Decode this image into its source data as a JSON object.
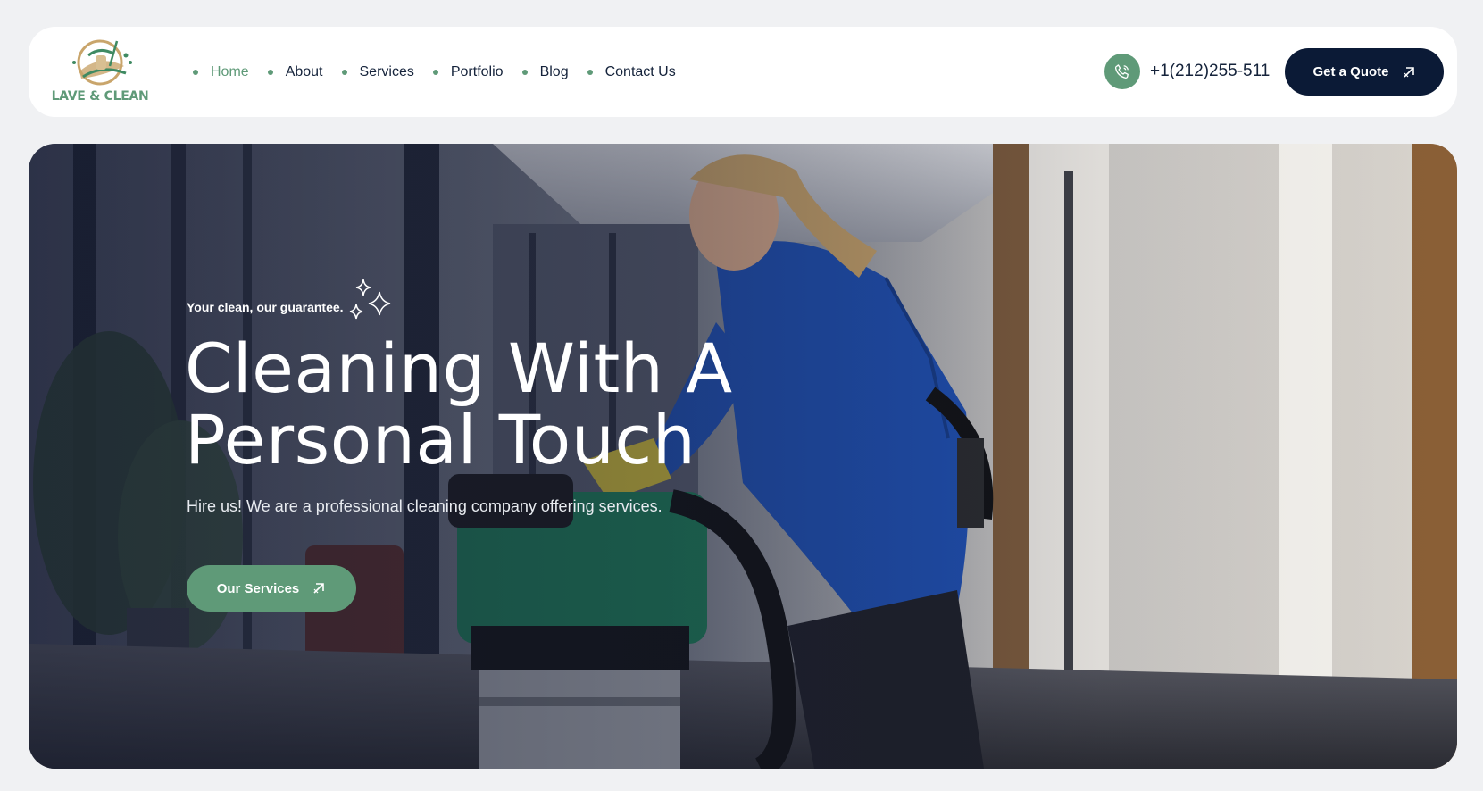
{
  "brand": {
    "name": "LAVE & CLEAN",
    "accent": "#5f9a78",
    "dark": "#0b1a36"
  },
  "nav": {
    "items": [
      {
        "label": "Home",
        "active": true
      },
      {
        "label": "About",
        "active": false
      },
      {
        "label": "Services",
        "active": false
      },
      {
        "label": "Portfolio",
        "active": false
      },
      {
        "label": "Blog",
        "active": false
      },
      {
        "label": "Contact Us",
        "active": false
      }
    ]
  },
  "contact": {
    "phone": "+1(212)255-511",
    "icon": "phone-icon"
  },
  "header_cta": {
    "label": "Get a Quote",
    "icon": "arrow-up-right-icon"
  },
  "hero": {
    "tagline": "Your clean, our guarantee.",
    "title_line1": "Cleaning With A",
    "title_line2": "Personal Touch",
    "subtitle": "Hire us! We are a professional cleaning company offering services.",
    "cta_label": "Our Services",
    "cta_icon": "arrow-up-right-icon",
    "image": "cleaner-with-vacuum-in-office-hallway"
  }
}
